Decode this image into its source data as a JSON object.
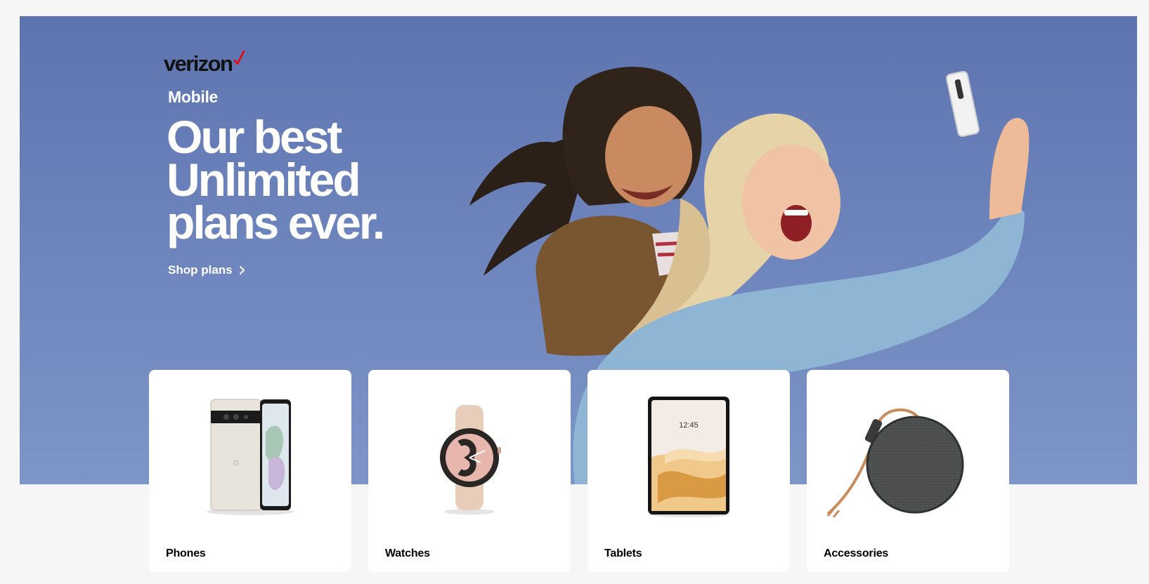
{
  "brand": {
    "logo_text": "verizon",
    "logo_mark": "red-checkmark",
    "accent_color": "#ee0000"
  },
  "hero": {
    "eyebrow": "Mobile",
    "headline_lines": [
      "Our best",
      "Unlimited",
      "plans ever."
    ],
    "cta_label": "Shop plans",
    "cta_icon": "chevron-right-icon",
    "background_color": "#6c82bc"
  },
  "categories": [
    {
      "label": "Phones",
      "icon": "phone-icon"
    },
    {
      "label": "Watches",
      "icon": "watch-icon"
    },
    {
      "label": "Tablets",
      "icon": "tablet-icon"
    },
    {
      "label": "Accessories",
      "icon": "speaker-icon"
    }
  ],
  "tablet_screen": {
    "time": "12:45"
  }
}
